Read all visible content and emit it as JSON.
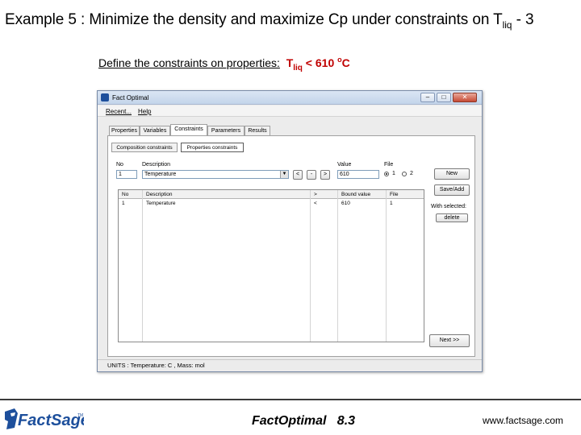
{
  "slide": {
    "title_main": "Example 5 : Minimize the density and maximize Cp under constraints on T",
    "title_sub": "liq",
    "title_tail": "  - 3",
    "subtitle_prefix": "Define the constraints on properties:",
    "subtitle_t": "T",
    "subtitle_sub": "liq",
    "subtitle_value": " < 610 ",
    "subtitle_deg": "o",
    "subtitle_unit": "C"
  },
  "window": {
    "title": "Fact Optimal",
    "min_glyph": "–",
    "max_glyph": "□",
    "close_glyph": "✕",
    "menu": [
      "Recent...",
      "Help"
    ],
    "tabs": [
      "Properties",
      "Variables",
      "Constraints",
      "Parameters",
      "Results"
    ],
    "active_tab": "Constraints",
    "subtabs": [
      "Composition constraints",
      "Properties constraints"
    ],
    "active_subtab": "Properties constraints",
    "form": {
      "no_label": "No",
      "no_value": "1",
      "description_label": "Description",
      "description_value": "Temperature",
      "description_arrow": "▼",
      "op_lt": "<",
      "op_minus": "-",
      "op_gt": ">",
      "value_label": "Value",
      "value_value": "610",
      "file_label": "File",
      "file_opt1": "1",
      "file_opt2": "2"
    },
    "buttons": {
      "new": "New",
      "save_add": "Save/Add",
      "with_selected": "With selected:",
      "delete": "delete",
      "next": "Next >>"
    },
    "table": {
      "headers": [
        "No",
        "Description",
        ">",
        "Bound value",
        "File"
      ],
      "rows": [
        [
          "1",
          "Temperature",
          "<",
          "610",
          "1"
        ]
      ]
    },
    "status": "UNITS : Temperature: C , Mass: mol"
  },
  "footer": {
    "logo_text": "FactSage",
    "logo_tm": "TM",
    "center": "FactOptimal   8.3",
    "right": "www.factsage.com"
  },
  "colors": {
    "accent_red": "#c00000",
    "logo_blue": "#1d4f9c"
  }
}
